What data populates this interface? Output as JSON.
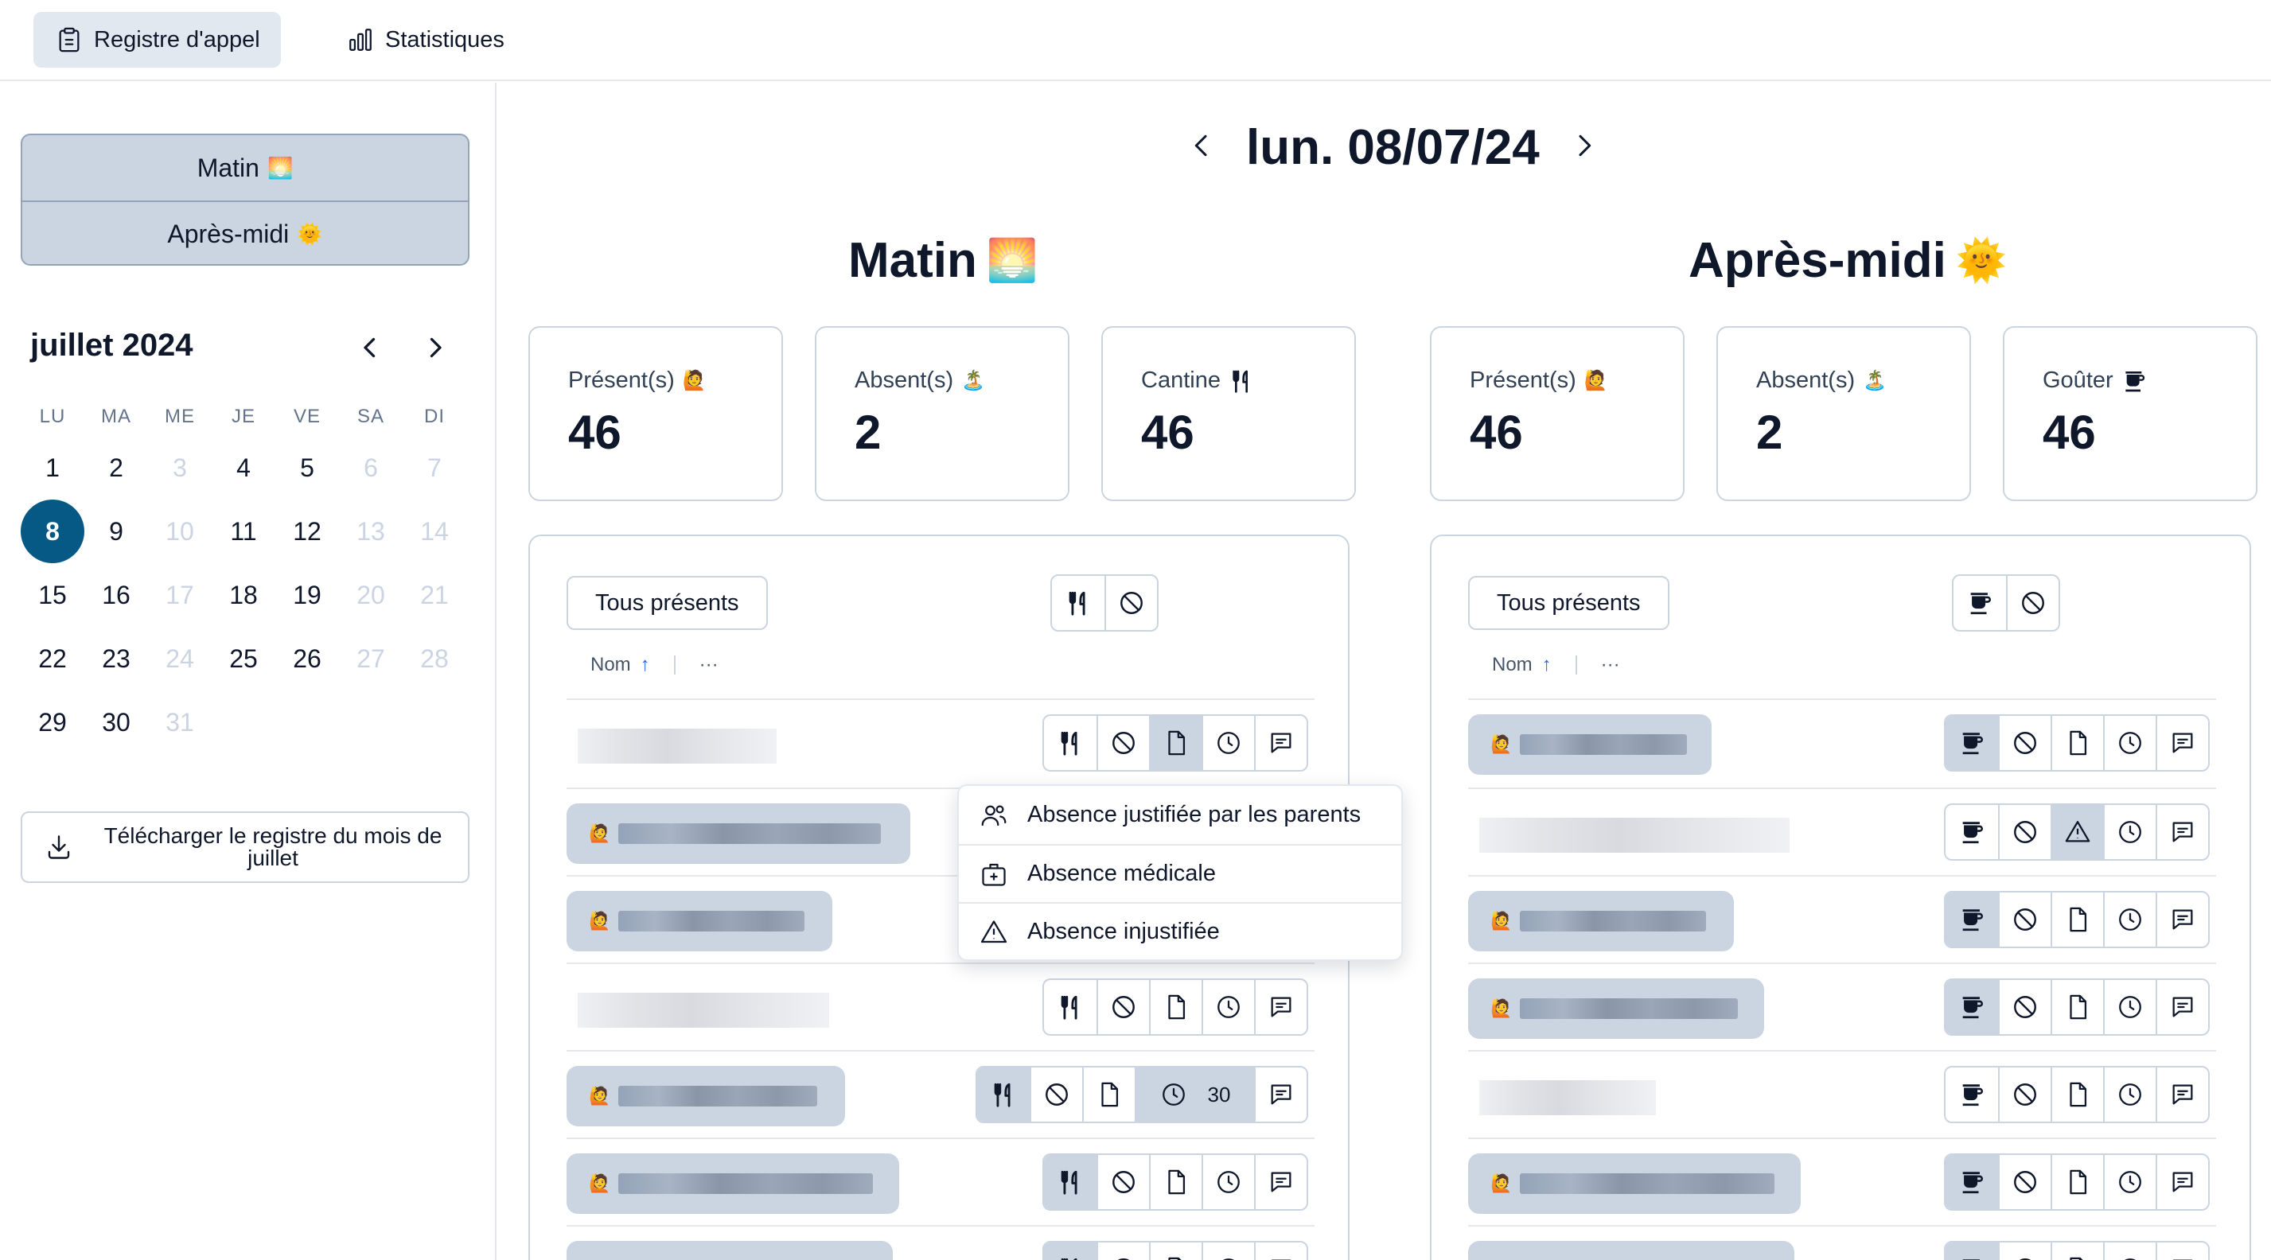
{
  "nav": {
    "register_label": "Registre d'appel",
    "stats_label": "Statistiques"
  },
  "sidebar": {
    "periods": [
      {
        "label": "Matin",
        "emoji": "🌅"
      },
      {
        "label": "Après-midi",
        "emoji": "🌞"
      }
    ],
    "calendar": {
      "month_label": "juillet 2024",
      "weekdays": [
        "LU",
        "MA",
        "ME",
        "JE",
        "VE",
        "SA",
        "DI"
      ],
      "days": [
        {
          "d": "1",
          "muted": false
        },
        {
          "d": "2",
          "muted": false
        },
        {
          "d": "3",
          "muted": true
        },
        {
          "d": "4",
          "muted": false
        },
        {
          "d": "5",
          "muted": false
        },
        {
          "d": "6",
          "muted": true
        },
        {
          "d": "7",
          "muted": true
        },
        {
          "d": "8",
          "muted": false,
          "selected": true
        },
        {
          "d": "9",
          "muted": false
        },
        {
          "d": "10",
          "muted": true
        },
        {
          "d": "11",
          "muted": false
        },
        {
          "d": "12",
          "muted": false
        },
        {
          "d": "13",
          "muted": true
        },
        {
          "d": "14",
          "muted": true
        },
        {
          "d": "15",
          "muted": false
        },
        {
          "d": "16",
          "muted": false
        },
        {
          "d": "17",
          "muted": true
        },
        {
          "d": "18",
          "muted": false
        },
        {
          "d": "19",
          "muted": false
        },
        {
          "d": "20",
          "muted": true
        },
        {
          "d": "21",
          "muted": true
        },
        {
          "d": "22",
          "muted": false
        },
        {
          "d": "23",
          "muted": false
        },
        {
          "d": "24",
          "muted": true
        },
        {
          "d": "25",
          "muted": false
        },
        {
          "d": "26",
          "muted": false
        },
        {
          "d": "27",
          "muted": true
        },
        {
          "d": "28",
          "muted": true
        },
        {
          "d": "29",
          "muted": false
        },
        {
          "d": "30",
          "muted": false
        },
        {
          "d": "31",
          "muted": true
        }
      ]
    },
    "download_label": "Télécharger le registre du mois de juillet"
  },
  "main": {
    "date": "lun. 08/07/24",
    "morning": {
      "title": "Matin",
      "emoji": "🌅",
      "stats": [
        {
          "label": "Présent(s)",
          "emoji": "🙋",
          "value": "46"
        },
        {
          "label": "Absent(s)",
          "emoji": "🏝️",
          "value": "2"
        },
        {
          "label": "Cantine",
          "icon": "fork-knife-icon",
          "value": "46"
        }
      ],
      "all_present_label": "Tous présents",
      "sort_label": "Nom",
      "more_label": "···",
      "late_minutes": "30"
    },
    "afternoon": {
      "title": "Après-midi",
      "emoji": "🌞",
      "stats": [
        {
          "label": "Présent(s)",
          "emoji": "🙋",
          "value": "46"
        },
        {
          "label": "Absent(s)",
          "emoji": "🏝️",
          "value": "2"
        },
        {
          "label": "Goûter",
          "icon": "cup-icon",
          "value": "46"
        }
      ],
      "all_present_label": "Tous présents",
      "sort_label": "Nom",
      "more_label": "···"
    },
    "present_emoji": "🙋",
    "absence_menu": [
      {
        "label": "Absence justifiée par les parents",
        "icon": "users-icon"
      },
      {
        "label": "Absence médicale",
        "icon": "medical-kit-icon"
      },
      {
        "label": "Absence injustifiée",
        "icon": "warning-icon"
      }
    ]
  },
  "colors": {
    "accent": "#075985",
    "selected_bg": "#cbd5e1",
    "border": "#cbd5e1"
  }
}
